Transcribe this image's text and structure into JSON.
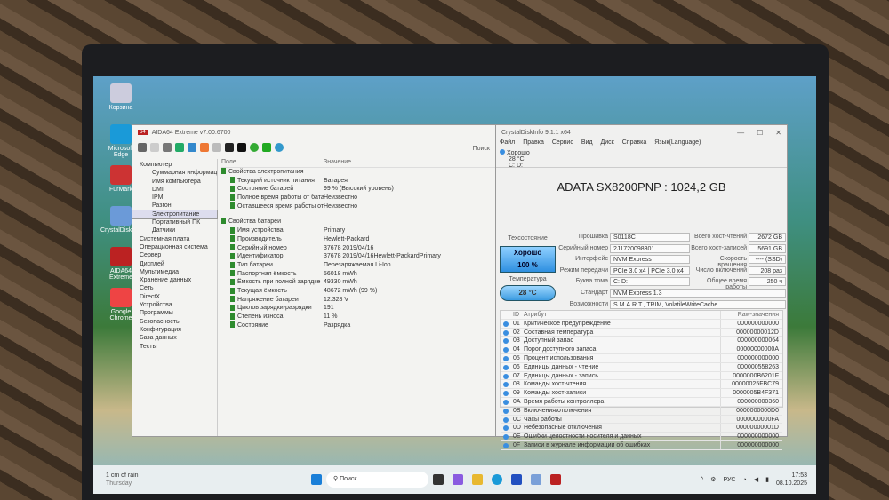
{
  "desktop": {
    "icons": [
      "Корзина",
      "Microsoft Edge",
      "FurMark",
      "CrystalDiskInfo",
      "AIDA64 Extreme",
      "Google Chrome"
    ]
  },
  "aida": {
    "title": "AIDA64 Extreme v7.00.6700",
    "search": "Поиск",
    "tree": [
      {
        "label": "Компьютер",
        "level": 0
      },
      {
        "label": "Суммарная информация",
        "level": 1
      },
      {
        "label": "Имя компьютера",
        "level": 1
      },
      {
        "label": "DMI",
        "level": 1
      },
      {
        "label": "IPMI",
        "level": 1
      },
      {
        "label": "Разгон",
        "level": 1
      },
      {
        "label": "Электропитание",
        "level": 1,
        "selected": true
      },
      {
        "label": "Портативный ПК",
        "level": 1
      },
      {
        "label": "Датчики",
        "level": 1
      },
      {
        "label": "Системная плата",
        "level": 0
      },
      {
        "label": "Операционная система",
        "level": 0
      },
      {
        "label": "Сервер",
        "level": 0
      },
      {
        "label": "Дисплей",
        "level": 0
      },
      {
        "label": "Мультимедиа",
        "level": 0
      },
      {
        "label": "Хранение данных",
        "level": 0
      },
      {
        "label": "Сеть",
        "level": 0
      },
      {
        "label": "DirectX",
        "level": 0
      },
      {
        "label": "Устройства",
        "level": 0
      },
      {
        "label": "Программы",
        "level": 0
      },
      {
        "label": "Безопасность",
        "level": 0
      },
      {
        "label": "Конфигурация",
        "level": 0
      },
      {
        "label": "База данных",
        "level": 0
      },
      {
        "label": "Тесты",
        "level": 0
      }
    ],
    "col_field": "Поле",
    "col_value": "Значение",
    "sections": [
      {
        "title": "Свойства электропитания",
        "rows": [
          [
            "Текущий источник питания",
            "Батарея"
          ],
          [
            "Состояние батарей",
            "99 % (Высокий уровень)"
          ],
          [
            "Полное время работы от бата...",
            "Неизвестно"
          ],
          [
            "Оставшееся время работы от ...",
            "Неизвестно"
          ]
        ]
      },
      {
        "title": "Свойства батареи",
        "rows": [
          [
            "Имя устройства",
            "Primary"
          ],
          [
            "Производитель",
            "Hewlett-Packard"
          ],
          [
            "Серийный номер",
            "37678 2019/04/16"
          ],
          [
            "Идентификатор",
            "37678 2019/04/16Hewlett-PackardPrimary"
          ],
          [
            "Тип батареи",
            "Перезаряжаемая Li-Ion"
          ],
          [
            "Паспортная ёмкость",
            "56018 mWh"
          ],
          [
            "Ёмкость при полной зарядке",
            "49330 mWh"
          ],
          [
            "Текущая ёмкость",
            "48672 mWh  (99 %)"
          ],
          [
            "Напряжение батареи",
            "12.328 V"
          ],
          [
            "Циклов зарядки-разрядки",
            "191"
          ],
          [
            "Степень износа",
            "11 %"
          ],
          [
            "Состояние",
            "Разрядка"
          ]
        ]
      }
    ]
  },
  "cdi": {
    "title": "CrystalDiskInfo 9.1.1 x64",
    "menu": [
      "Файл",
      "Правка",
      "Сервис",
      "Вид",
      "Диск",
      "Справка",
      "Язык(Language)"
    ],
    "disk_tab": {
      "status": "Хорошо",
      "temp": "28 °C",
      "letter": "C: D:"
    },
    "model": "ADATA SX8200PNP : 1024,2 GB",
    "health_label": "Техсостояние",
    "health": "Хорошо",
    "health_pct": "100 %",
    "temp_label": "Температура",
    "temp": "28 °C",
    "left_fields": [
      [
        "Прошивка",
        "S0118C"
      ],
      [
        "Серийный номер",
        "2J1720098301"
      ],
      [
        "Интерфейс",
        "NVM Express"
      ],
      [
        "Режим передачи",
        "PCIe 3.0 x4 | PCIe 3.0 x4"
      ],
      [
        "Буква тома",
        "C: D:"
      ]
    ],
    "right_fields": [
      [
        "Всего хост-чтений",
        "2672 GB"
      ],
      [
        "Всего хост-записей",
        "5691 GB"
      ],
      [
        "Скорость вращения",
        "---- (SSD)"
      ],
      [
        "Число включений",
        "208 раз"
      ],
      [
        "Общее время работы",
        "250 ч"
      ]
    ],
    "wide_fields": [
      [
        "Стандарт",
        "NVM Express 1.3"
      ],
      [
        "Возможности",
        "S.M.A.R.T., TRIM, VolatileWriteCache"
      ]
    ],
    "smart_headers": [
      "ID",
      "Атрибут",
      "Raw-значения"
    ],
    "smart": [
      [
        "01",
        "Критическое предупреждение",
        "000000000000"
      ],
      [
        "02",
        "Составная температура",
        "00000000012D"
      ],
      [
        "03",
        "Доступный запас",
        "000000000064"
      ],
      [
        "04",
        "Порог доступного запаса",
        "00000000000A"
      ],
      [
        "05",
        "Процент использования",
        "000000000000"
      ],
      [
        "06",
        "Единицы данных - чтение",
        "000000558263"
      ],
      [
        "07",
        "Единицы данных - запись",
        "0000000B6201F"
      ],
      [
        "08",
        "Команды хост-чтения",
        "00000025FBC79"
      ],
      [
        "09",
        "Команды хост-записи",
        "0000005B4F371"
      ],
      [
        "0A",
        "Время работы контроллера",
        "000000000360"
      ],
      [
        "0B",
        "Включения/отключения",
        "0000000000D0"
      ],
      [
        "0C",
        "Часы работы",
        "0000000000FA"
      ],
      [
        "0D",
        "Небезопасные отключения",
        "00000000001D"
      ],
      [
        "0E",
        "Ошибки целостности носителя и данных",
        "000000000000"
      ],
      [
        "0F",
        "Записи в журнале информации об ошибках",
        "000000000000"
      ]
    ]
  },
  "taskbar": {
    "weather": "1 cm of rain",
    "day": "Thursday",
    "search": "Поиск",
    "lang": "РУС",
    "time": "17:53",
    "date": "08.10.2025"
  }
}
